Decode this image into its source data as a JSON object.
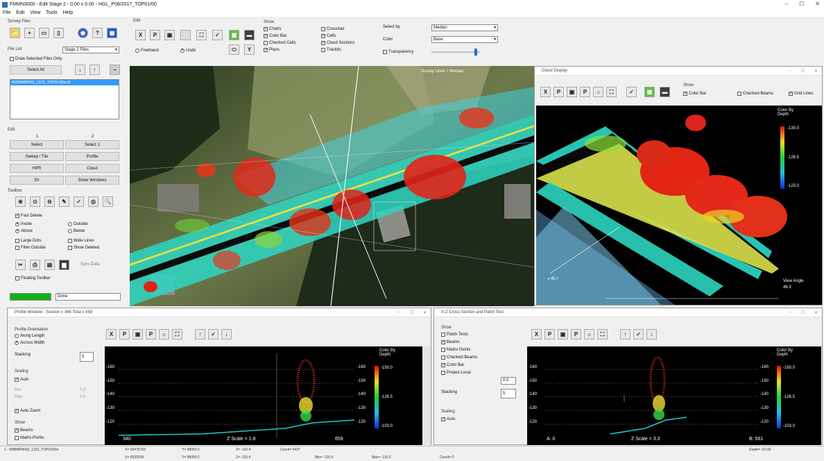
{
  "window": {
    "title": "FMMN3000 - Edit Stage 2 - 0.00 x 0.00 - HGL_P08/2017_TOP01/00",
    "min": "–",
    "max": "☐",
    "close": "✕"
  },
  "menu": [
    "File",
    "Edit",
    "View",
    "Tools",
    "Help"
  ],
  "survey_files": {
    "title": "Survey Files",
    "file_list_label": "File List",
    "file_list_value": "Stage 2 Files",
    "draw_selected": "Draw Selected Files Only",
    "select_all": "Select All",
    "file_item": "00DMMN000_1323_TOP01/00a.tif"
  },
  "edit_section": {
    "title": "Edit",
    "col1": "1",
    "col2": "2",
    "buttons": [
      [
        "Select",
        "Select 1"
      ],
      [
        "Sweep / Tile",
        "Profile"
      ],
      [
        "HPR",
        "Cloud"
      ],
      [
        "3V",
        "Show Windows"
      ]
    ]
  },
  "toolbox": {
    "title": "Toolbox",
    "options": {
      "fast_delete": "Fast Delete",
      "inside": "Inside",
      "outside": "Outside",
      "above": "Above",
      "below": "Below",
      "large_dots": "Large Dots",
      "wide_lines": "Wide Lines",
      "filter_outside": "Filter Outside",
      "show_deleted": "Show Deleted",
      "floating_toolbar": "Floating Toolbar"
    },
    "sync": "Sync Data",
    "status_text": "Done"
  },
  "edit_toolbar": {
    "title": "Edit",
    "freehand": "Freehand",
    "undo": "Undo"
  },
  "show_group": {
    "title": "Show",
    "items": [
      "Charts",
      "Color Bar",
      "Checked Cells",
      "Plans",
      "Crosshair",
      "Cells",
      "Cloud Sections",
      "Tracklts"
    ]
  },
  "color_group": {
    "select_label": "Select by",
    "color_label": "Color",
    "select_value": "Median",
    "color_value": "Base",
    "transparency": "Transparency"
  },
  "map": {
    "overlay_label": "Survey Lines + Median"
  },
  "cloud_display": {
    "title": "Cloud Display",
    "show": "Show",
    "color_bar": "Color Bar",
    "checked_beams": "Checked Beams",
    "grid_lines": "Grid Lines",
    "color_by": "Color By Depth",
    "ticks": [
      "-130.0",
      "-126.5",
      "-123.0"
    ],
    "view_angle_label": "View Angle",
    "view_angle": "46.3",
    "compass": "45"
  },
  "profile_window": {
    "title": "Profile Window - Section x 346 Total x 659",
    "orientation": "Profile Orientation",
    "along": "Along Length",
    "across": "Across Width",
    "stacking": "Stacking",
    "stacking_value": "5",
    "scaling": "Scaling",
    "auto": "Auto",
    "min_label": "Min",
    "max_label": "Max",
    "min_value": "0.0",
    "max_value": "0.0",
    "auto_zoom": "Auto Zoom",
    "show": "Show",
    "beams": "Beams",
    "matrix": "Matrix Points",
    "ticks": [
      "-160",
      "-150",
      "-140",
      "-130",
      "-120"
    ],
    "right_ticks": [
      "-160",
      "-150",
      "-140",
      "-130",
      "-120"
    ],
    "cb_title": "Color By Depth",
    "cb_ticks": [
      "-150.0",
      "-126.5",
      "-103.0"
    ],
    "xleft": "340",
    "xright": "659",
    "zscale": "Z Scale = 1.8"
  },
  "cross_window": {
    "title": "X-Z Cross Section and Patch Test",
    "show": "Show",
    "items": [
      "Patch Tests",
      "Beams",
      "Matrix Points",
      "Checked Beams",
      "Color Bar",
      "Project Local"
    ],
    "project_value": "0.0",
    "stacking": "Stacking",
    "stacking_value": "5",
    "scaling": "Scaling",
    "auto": "Auto",
    "ticks": [
      "-160",
      "-150",
      "-140",
      "-130",
      "-120"
    ],
    "right_ticks": [
      "-160",
      "-150",
      "-140",
      "-130",
      "-120"
    ],
    "cb_title": "Color By Depth",
    "cb_ticks": [
      "-150.0",
      "-126.5",
      "-103.0"
    ],
    "aleft": "A: 0",
    "bright": "B: 561",
    "zscale": "Z Scale = 3.3"
  },
  "status": {
    "file": "1 - 00BMMN000_1323_TOP01/00s",
    "x": "X= 29475753",
    "y": "Y= 98050.2",
    "z": "Z= -115.4",
    "count": "Count= 5437",
    "x2": "X= 9932528",
    "y2": "Y= 98050.2",
    "z2": "Z= -115.4",
    "min": "Min= -116.4",
    "max": "Max= -110.2",
    "count2": "Count= 0",
    "depth": "Depth= 12143"
  },
  "colors": {
    "accent_green": "#12b01d",
    "selection_blue": "#3399ff"
  }
}
